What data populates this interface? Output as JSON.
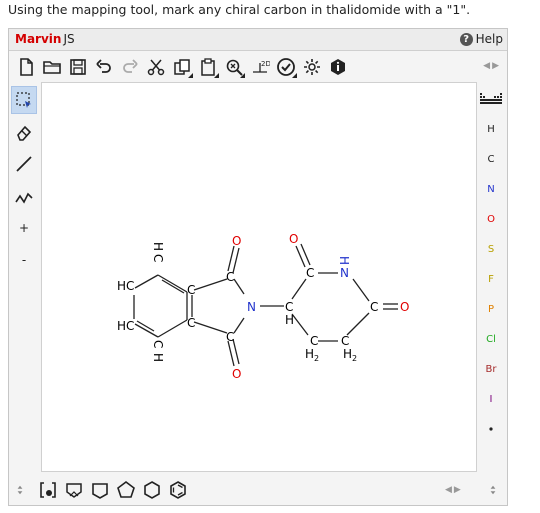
{
  "prompt": "Using the mapping tool, mark any chiral carbon in thalidomide with a \"1\".",
  "app": {
    "brand": "Marvin",
    "brand_sub": "JS",
    "help_label": "Help",
    "help_icon": "?"
  },
  "toolbar_top": {
    "clean2d_label": "2D"
  },
  "left_toolbar": {
    "plus_label": "+",
    "minus_label": "-"
  },
  "periodic": {
    "elements": [
      "H",
      "C",
      "N",
      "O",
      "S",
      "F",
      "P",
      "Cl",
      "Br",
      "I"
    ],
    "colors": {
      "H": "#222222",
      "C": "#222222",
      "N": "#2233cc",
      "O": "#e00000",
      "S": "#b8a000",
      "F": "#b8a000",
      "P": "#e08000",
      "Cl": "#22aa22",
      "Br": "#a52a2a",
      "I": "#7a007a"
    }
  },
  "scroll": {
    "left": "◀",
    "right": "▶"
  },
  "molecule": {
    "atoms": {
      "hc_top": "HC",
      "hc_bottom": "HC",
      "ch_top_c": "C",
      "ch_top_h": "H",
      "ch_bottom_c": "C",
      "ch_bottom_h": "H",
      "c_ring_top": "C",
      "c_ring_bottom": "C",
      "c_carbonyl_top": "C",
      "c_carbonyl_bottom": "C",
      "o_top_left": "O",
      "o_bottom_left": "O",
      "n_imide": "N",
      "c_alpha": "C",
      "h_alpha": "H",
      "c_carbonyl_pip": "C",
      "o_pip_top": "O",
      "n_pip": "N",
      "h_n_pip": "H",
      "c_carbonyl_pip2": "C",
      "o_pip_right": "O",
      "ch2_a_c": "C",
      "ch2_a_h": "H",
      "ch2_a_sub": "2",
      "ch2_b_c": "C",
      "ch2_b_h": "H",
      "ch2_b_sub": "2"
    },
    "colors": {
      "carbon": "#222222",
      "nitrogen": "#2233cc",
      "oxygen": "#e00000"
    }
  }
}
